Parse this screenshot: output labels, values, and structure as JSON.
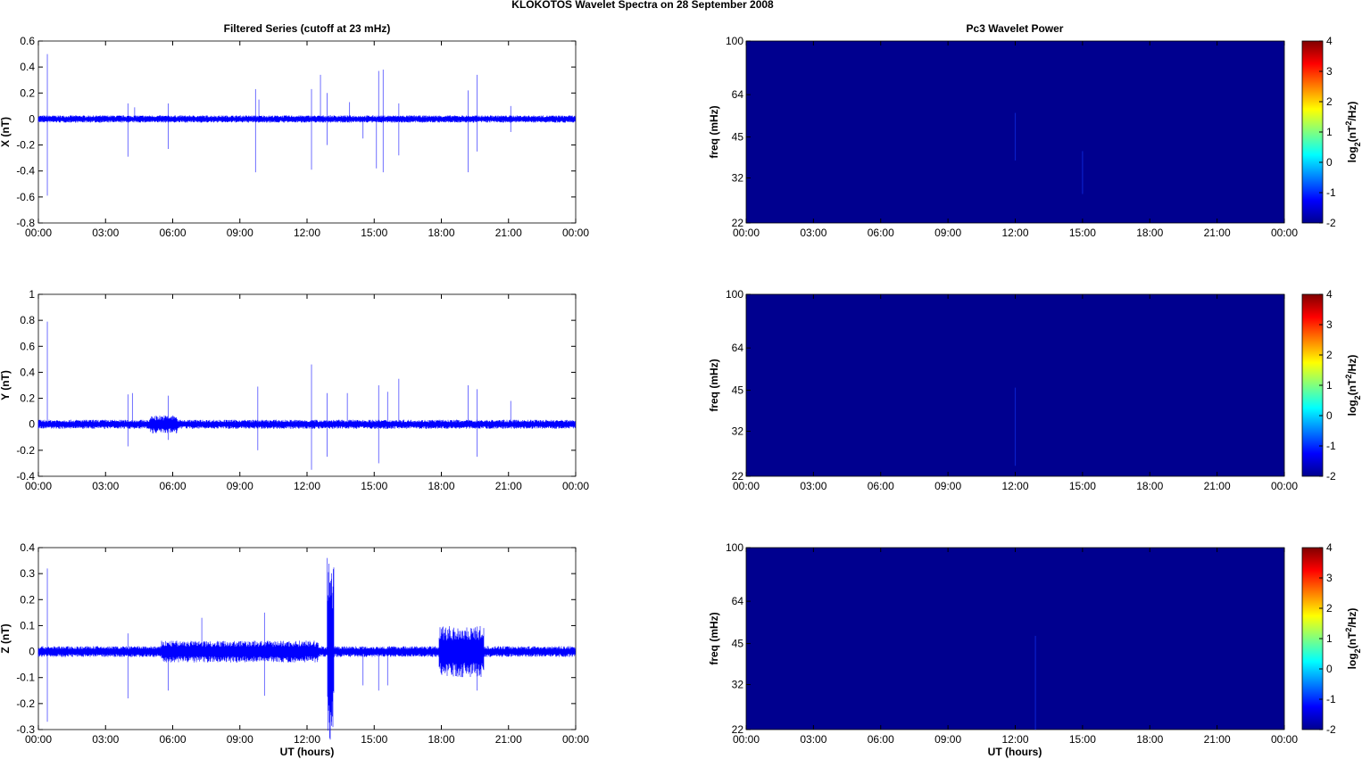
{
  "chart_data": {
    "title": "KLOKOTOS Wavelet Spectra on 28 September 2008",
    "left_title": "Filtered Series (cutoff at 23 mHz)",
    "right_title": "Pc3 Wavelet Power",
    "xlabel": "UT (hours)",
    "xlim_hours": [
      0,
      24
    ],
    "xticks": [
      "00:00",
      "03:00",
      "06:00",
      "09:00",
      "12:00",
      "15:00",
      "18:00",
      "21:00",
      "00:00"
    ],
    "series": [
      {
        "type": "line",
        "name": "X",
        "ylabel": "X (nT)",
        "color": "#0000ff",
        "ylim": [
          -0.8,
          0.6
        ],
        "yticks": [
          "0.6",
          "0.4",
          "0.2",
          "0",
          "-0.2",
          "-0.4",
          "-0.6",
          "-0.8"
        ],
        "noise_amplitude": 0.02,
        "bursts": [],
        "spikes": [
          [
            0.4,
            0.5
          ],
          [
            0.4,
            -0.59
          ],
          [
            4.0,
            -0.29
          ],
          [
            4.0,
            0.12
          ],
          [
            4.3,
            0.09
          ],
          [
            5.8,
            -0.23
          ],
          [
            5.8,
            0.12
          ],
          [
            9.7,
            0.23
          ],
          [
            9.7,
            -0.41
          ],
          [
            9.85,
            0.15
          ],
          [
            12.2,
            -0.39
          ],
          [
            12.2,
            0.23
          ],
          [
            12.6,
            0.34
          ],
          [
            12.9,
            -0.2
          ],
          [
            12.9,
            0.2
          ],
          [
            13.9,
            0.13
          ],
          [
            14.5,
            -0.15
          ],
          [
            15.1,
            -0.38
          ],
          [
            15.2,
            0.37
          ],
          [
            15.4,
            0.38
          ],
          [
            15.4,
            -0.41
          ],
          [
            16.1,
            -0.28
          ],
          [
            16.1,
            0.12
          ],
          [
            19.2,
            -0.41
          ],
          [
            19.2,
            0.22
          ],
          [
            19.6,
            0.34
          ],
          [
            19.6,
            -0.25
          ],
          [
            21.1,
            0.1
          ],
          [
            21.1,
            -0.1
          ]
        ]
      },
      {
        "type": "line",
        "name": "Y",
        "ylabel": "Y (nT)",
        "color": "#0000ff",
        "ylim": [
          -0.4,
          1
        ],
        "yticks": [
          "1",
          "0.8",
          "0.6",
          "0.4",
          "0.2",
          "0",
          "-0.2",
          "-0.4"
        ],
        "noise_amplitude": 0.025,
        "bursts": [
          [
            5.0,
            6.2,
            0.05
          ]
        ],
        "spikes": [
          [
            0.4,
            0.79
          ],
          [
            4.0,
            0.23
          ],
          [
            4.0,
            -0.17
          ],
          [
            4.2,
            0.24
          ],
          [
            5.8,
            0.22
          ],
          [
            5.8,
            -0.12
          ],
          [
            9.8,
            0.29
          ],
          [
            9.8,
            -0.2
          ],
          [
            12.2,
            0.46
          ],
          [
            12.2,
            -0.35
          ],
          [
            12.9,
            0.24
          ],
          [
            12.9,
            -0.25
          ],
          [
            13.8,
            0.24
          ],
          [
            15.2,
            0.3
          ],
          [
            15.2,
            -0.3
          ],
          [
            15.6,
            0.25
          ],
          [
            16.1,
            0.35
          ],
          [
            19.2,
            0.3
          ],
          [
            19.6,
            0.27
          ],
          [
            19.6,
            -0.25
          ],
          [
            21.1,
            0.18
          ]
        ]
      },
      {
        "type": "line",
        "name": "Z",
        "ylabel": "Z (nT)",
        "color": "#0000ff",
        "ylim": [
          -0.3,
          0.4
        ],
        "yticks": [
          "0.4",
          "0.3",
          "0.2",
          "0.1",
          "0",
          "-0.1",
          "-0.2",
          "-0.3"
        ],
        "noise_amplitude": 0.015,
        "bursts": [
          [
            12.9,
            13.2,
            0.25
          ],
          [
            17.9,
            19.9,
            0.07
          ],
          [
            5.5,
            12.5,
            0.03
          ]
        ],
        "spikes": [
          [
            0.4,
            0.32
          ],
          [
            0.4,
            -0.27
          ],
          [
            4.0,
            -0.18
          ],
          [
            4.0,
            0.07
          ],
          [
            5.8,
            -0.15
          ],
          [
            7.3,
            0.13
          ],
          [
            10.1,
            0.15
          ],
          [
            10.1,
            -0.17
          ],
          [
            12.9,
            0.36
          ],
          [
            13.1,
            -0.27
          ],
          [
            13.1,
            0.28
          ],
          [
            14.5,
            -0.13
          ],
          [
            15.2,
            -0.15
          ],
          [
            15.6,
            -0.13
          ],
          [
            19.6,
            -0.15
          ]
        ]
      }
    ],
    "wavelet": [
      {
        "type": "heatmap",
        "ylabel": "freq (mHz)",
        "yticks": [
          "100",
          "64",
          "45",
          "32",
          "22"
        ],
        "colorbar_label": "log2(nT^2/Hz)",
        "clim": [
          -2,
          4
        ],
        "cticks": [
          "4",
          "3",
          "2",
          "1",
          "0",
          "-1",
          "-2"
        ],
        "background_value": -2,
        "features": [
          [
            12.0,
            37,
            55
          ],
          [
            15.0,
            28,
            40
          ]
        ]
      },
      {
        "type": "heatmap",
        "ylabel": "freq (mHz)",
        "yticks": [
          "100",
          "64",
          "45",
          "32",
          "22"
        ],
        "colorbar_label": "log2(nT^2/Hz)",
        "clim": [
          -2,
          4
        ],
        "cticks": [
          "4",
          "3",
          "2",
          "1",
          "0",
          "-1",
          "-2"
        ],
        "background_value": -2,
        "features": [
          [
            12.0,
            24,
            46
          ]
        ]
      },
      {
        "type": "heatmap",
        "ylabel": "freq (mHz)",
        "yticks": [
          "100",
          "64",
          "45",
          "32",
          "22"
        ],
        "colorbar_label": "log2(nT^2/Hz)",
        "clim": [
          -2,
          4
        ],
        "cticks": [
          "4",
          "3",
          "2",
          "1",
          "0",
          "-1",
          "-2"
        ],
        "background_value": -2,
        "features": [
          [
            12.9,
            22,
            48
          ]
        ]
      }
    ]
  }
}
